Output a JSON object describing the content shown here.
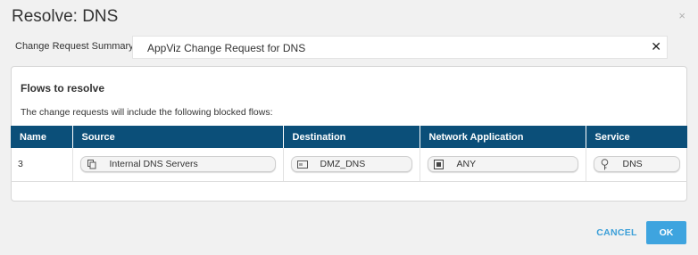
{
  "dialog": {
    "title": "Resolve: DNS",
    "close_glyph": "×"
  },
  "summary": {
    "label": "Change Request Summary:",
    "value": "AppViz Change Request for DNS",
    "clear_glyph": "✕"
  },
  "flows": {
    "heading": "Flows to resolve",
    "description": "The change requests will include the following blocked flows:",
    "columns": [
      "Name",
      "Source",
      "Destination",
      "Network Application",
      "Service"
    ],
    "rows": [
      {
        "name": "3",
        "source": {
          "label": "Internal DNS Servers",
          "icon": "copy-icon"
        },
        "destination": {
          "label": "DMZ_DNS",
          "icon": "network-object-icon"
        },
        "network_application": {
          "label": "ANY",
          "icon": "application-icon"
        },
        "service": {
          "label": "DNS",
          "icon": "service-icon"
        }
      }
    ]
  },
  "buttons": {
    "cancel": "CANCEL",
    "ok": "OK"
  },
  "colors": {
    "header_bg": "#0b4f79",
    "accent": "#3ea4df"
  }
}
